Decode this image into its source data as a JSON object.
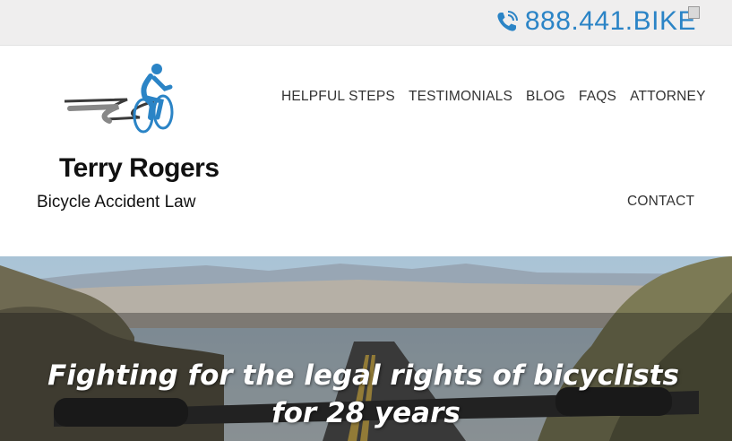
{
  "topbar": {
    "phone": "888.441.BIKE",
    "phone_icon": "phone-icon",
    "close_icon": "close-icon"
  },
  "logo": {
    "name": "Terry Rogers",
    "subtitle": "Bicycle Accident Law",
    "icon": "cyclist-icon"
  },
  "nav": {
    "items": [
      "HELPFUL STEPS",
      "TESTIMONIALS",
      "BLOG",
      "FAQS",
      "ATTORNEY"
    ],
    "contact": "CONTACT"
  },
  "hero": {
    "title_line1": "Fighting for the legal rights of bicyclists",
    "title_line2": "for 28 years"
  },
  "colors": {
    "accent_blue": "#2b84c6",
    "topbar_bg": "#efeeee",
    "nav_text": "#333333"
  }
}
